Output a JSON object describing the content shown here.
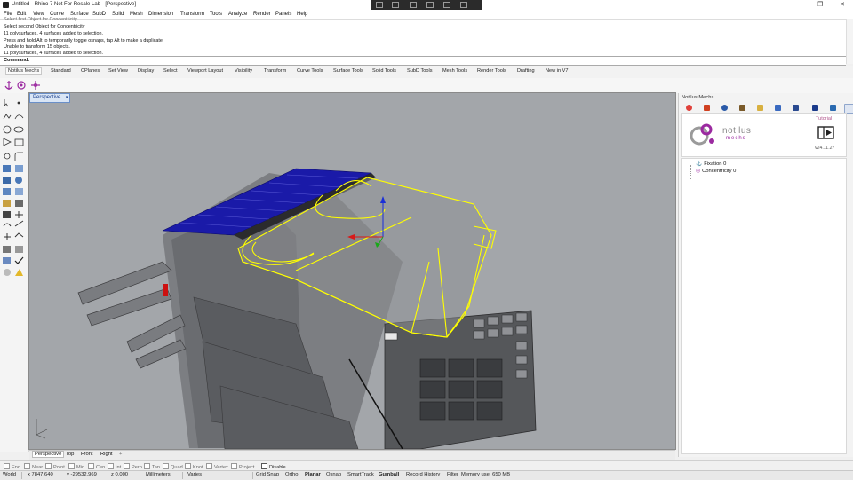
{
  "window": {
    "title": "Untitled - Rhino 7 Not For Resale Lab - [Perspective]"
  },
  "menu": [
    "File",
    "Edit",
    "View",
    "Curve",
    "Surface",
    "SubD",
    "Solid",
    "Mesh",
    "Dimension",
    "Transform",
    "Tools",
    "Analyze",
    "Render",
    "Panels",
    "Help"
  ],
  "command_history": [
    "Select first Object for Concentricity",
    "Select second Object for Concentricity",
    "11 polysurfaces, 4 surfaces added to selection.",
    "Press and hold Alt to temporarily toggle osnaps, tap Alt to make a duplicate",
    "Unable to transform 15 objects.",
    "11 polysurfaces, 4 surfaces added to selection."
  ],
  "command_prompt": "Command:",
  "toolbar_tabs": [
    "Notilus Mechs",
    "Standard",
    "CPlanes",
    "Set View",
    "Display",
    "Select",
    "Viewport Layout",
    "Visibility",
    "Transform",
    "Curve Tools",
    "Surface Tools",
    "Solid Tools",
    "SubD Tools",
    "Mesh Tools",
    "Render Tools",
    "Drafting",
    "New in V7"
  ],
  "viewport": {
    "name": "Perspective",
    "tabs": [
      "Perspective",
      "Top",
      "Front",
      "Right"
    ],
    "add_tab_symbol": "+"
  },
  "panel": {
    "title": "Notilus Mechs",
    "brand": "notilus",
    "brand_sub": "mechs",
    "tutorial_label": "Tutorial",
    "version": "v24.11.27",
    "tree": [
      "Fixation 0",
      "Concentricity 0"
    ]
  },
  "osnaps": [
    "End",
    "Near",
    "Point",
    "Mid",
    "Cen",
    "Int",
    "Perp",
    "Tan",
    "Quad",
    "Knot",
    "Vertex",
    "Project"
  ],
  "osnap_disable": "Disable",
  "status": {
    "cplane": "World",
    "x": "x 7847.640",
    "y": "y -29532.969",
    "z": "z 0.000",
    "units": "Millimeters",
    "layer": "Varies",
    "toggles": [
      "Grid Snap",
      "Ortho",
      "Planar",
      "Osnap",
      "SmartTrack",
      "Gumball",
      "Record History",
      "Filter"
    ],
    "memory": "Memory use: 650 MB"
  },
  "colors": {
    "selection": "#ffff00",
    "viewport_bg": "#a3a6aa",
    "blue_faces": "#1a1aa8"
  }
}
